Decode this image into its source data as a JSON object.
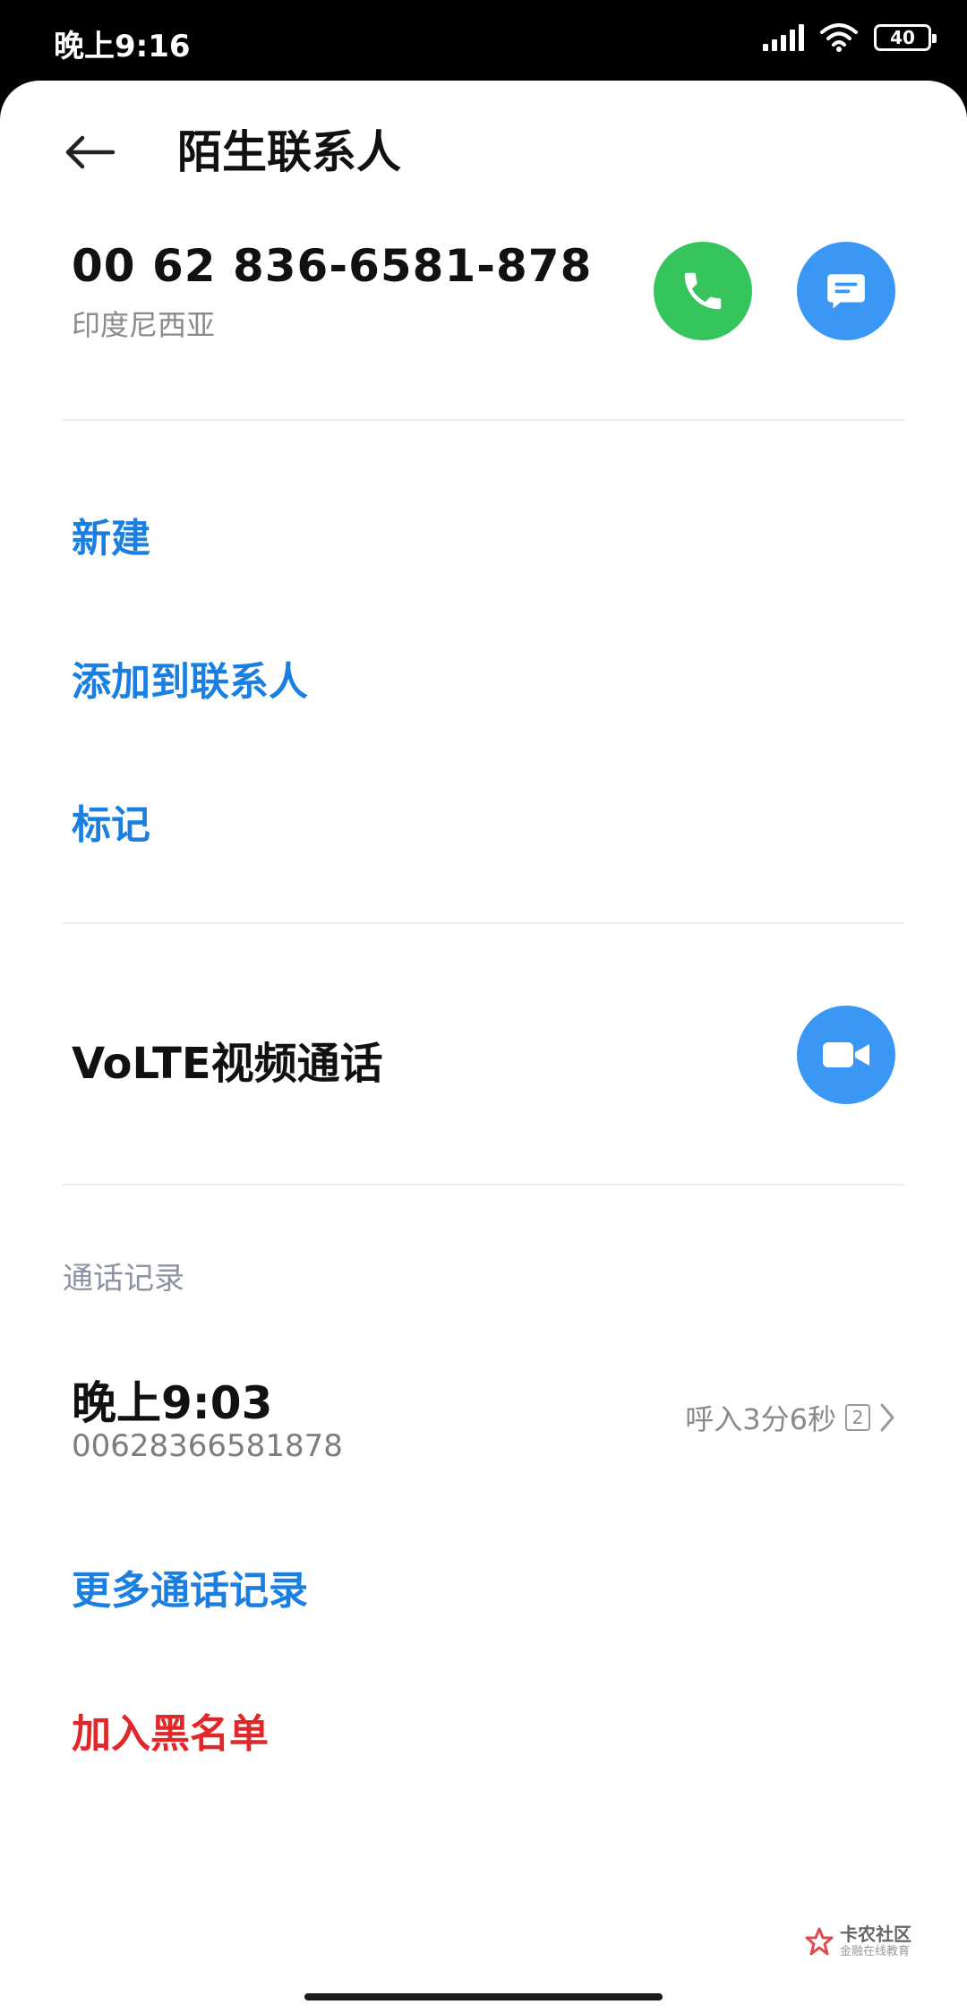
{
  "status_bar": {
    "time": "晚上9:16",
    "battery": "40"
  },
  "header": {
    "title": "陌生联系人"
  },
  "contact": {
    "number": "00 62 836-6581-878",
    "location": "印度尼西亚"
  },
  "actions": {
    "new": "新建",
    "add_to_contacts": "添加到联系人",
    "mark": "标记"
  },
  "volte": {
    "label": "VoLTE视频通话"
  },
  "call_log": {
    "section_title": "通话记录",
    "entries": [
      {
        "time": "晚上9:03",
        "number": "00628366581878",
        "detail": "呼入3分6秒",
        "sim": "2"
      }
    ]
  },
  "more_logs": "更多通话记录",
  "block": "加入黑名单",
  "watermark": {
    "main": "卡农社区",
    "sub": "金融在线教育"
  },
  "colors": {
    "accent": "#1a7fe0",
    "call_green": "#36c45c",
    "button_blue": "#3b97f4",
    "danger": "#e0282b"
  },
  "icons": [
    "back-arrow-icon",
    "phone-icon",
    "message-icon",
    "video-camera-icon",
    "chevron-right-icon",
    "wifi-icon",
    "signal-icon",
    "battery-icon"
  ]
}
